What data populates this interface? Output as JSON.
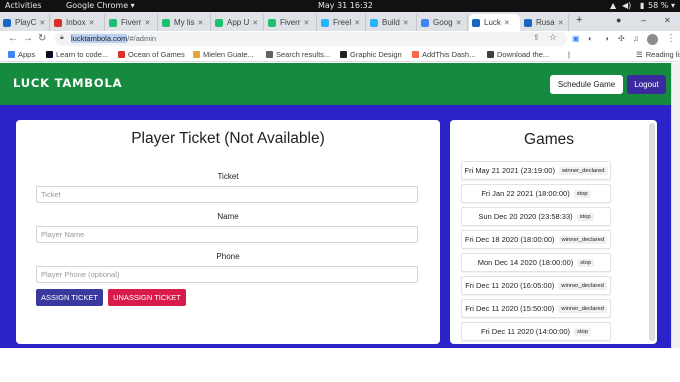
{
  "system": {
    "activities": "Activities",
    "app_menu": "Google Chrome ▾",
    "clock": "May 31  16:32",
    "battery": "58 %"
  },
  "tabs": [
    {
      "label": "PlayC",
      "icon": "vuetify-icon",
      "color": "#1867c0"
    },
    {
      "label": "Inbox",
      "icon": "gmail-icon",
      "color": "#d93025"
    },
    {
      "label": "Fiverr",
      "icon": "fiverr-icon",
      "color": "#1dbf73"
    },
    {
      "label": "My lis",
      "icon": "fiverr-icon",
      "color": "#1dbf73"
    },
    {
      "label": "App U",
      "icon": "fiverr-icon",
      "color": "#1dbf73"
    },
    {
      "label": "Fiverr",
      "icon": "fiverr-icon",
      "color": "#1dbf73"
    },
    {
      "label": "Freel",
      "icon": "freelancer-icon",
      "color": "#29b2fe"
    },
    {
      "label": "Build",
      "icon": "freelancer-icon",
      "color": "#29b2fe"
    },
    {
      "label": "Goog",
      "icon": "google-icon",
      "color": "#4285f4"
    },
    {
      "label": "Luck",
      "icon": "vuetify-icon",
      "color": "#1867c0"
    },
    {
      "label": "Rusa",
      "icon": "vuetify-icon",
      "color": "#1867c0"
    }
  ],
  "url": {
    "host": "lucktambola.com",
    "path": "/#/admin"
  },
  "bookmarks": [
    {
      "label": "Apps",
      "color": "#4285f4"
    },
    {
      "label": "Learn to code...",
      "color": "#0a0a23"
    },
    {
      "label": "Ocean of Games",
      "color": "#d9302c"
    },
    {
      "label": "Mielen Guate...",
      "color": "#e8a33d"
    },
    {
      "label": "Search results...",
      "color": "#5f6368"
    },
    {
      "label": "Graphic Design",
      "color": "#222222"
    },
    {
      "label": "AddThis Dash...",
      "color": "#f8694d"
    },
    {
      "label": "Download the...",
      "color": "#3c4043"
    }
  ],
  "reading_list": "Reading list",
  "app": {
    "brand": "LUCK TAMBOLA",
    "schedule_button": "Schedule Game",
    "logout_button": "Logout",
    "header_color": "#168a3e",
    "bg_color": "#2b22c8"
  },
  "ticket": {
    "title": "Player Ticket (Not Available)",
    "ticket_label": "Ticket",
    "ticket_placeholder": "Ticket",
    "name_label": "Name",
    "name_placeholder": "Player Name",
    "phone_label": "Phone",
    "phone_placeholder": "Player Phone (optional)",
    "assign_button": "ASSIGN TICKET",
    "unassign_button": "UNASSIGN TICKET"
  },
  "games": {
    "title": "Games",
    "items": [
      {
        "date": "Fri May 21 2021 (23:19:00)",
        "status": "winner_declared"
      },
      {
        "date": "Fri Jan 22 2021 (18:00:00)",
        "status": "stop"
      },
      {
        "date": "Sun Dec 20 2020 (23:58:33)",
        "status": "stop"
      },
      {
        "date": "Fri Dec 18 2020 (18:00:00)",
        "status": "winner_declared"
      },
      {
        "date": "Mon Dec 14 2020 (18:00:00)",
        "status": "stop"
      },
      {
        "date": "Fri Dec 11 2020 (16:05:00)",
        "status": "winner_declared"
      },
      {
        "date": "Fri Dec 11 2020 (15:50:00)",
        "status": "winner_declared"
      },
      {
        "date": "Fri Dec 11 2020 (14:00:00)",
        "status": "stop"
      }
    ]
  }
}
